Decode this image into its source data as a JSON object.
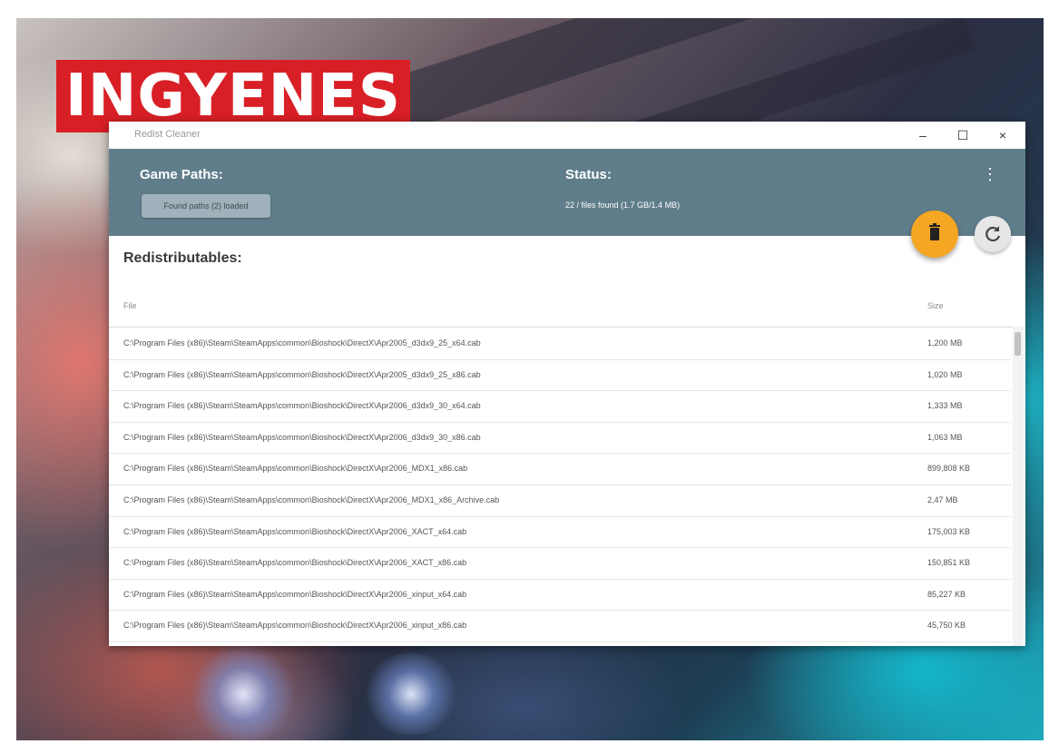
{
  "watermark": {
    "text": "INGYENES"
  },
  "window": {
    "title": "Redist Cleaner",
    "controls": {
      "minimize": "–",
      "maximize": "☐",
      "close": "×"
    }
  },
  "header": {
    "game_paths_label": "Game Paths:",
    "path_button_label": "Found paths (2) loaded",
    "status_label": "Status:",
    "status_text": "22 / files found (1.7 GB/1.4 MB)",
    "menu_icon": "⋮"
  },
  "actions": {
    "delete_icon": "trash-icon",
    "refresh_icon": "refresh-icon",
    "delete_color": "#f5a623"
  },
  "redistributables": {
    "title": "Redistributables:",
    "columns": {
      "file": "File",
      "size": "Size"
    },
    "rows": [
      {
        "file": "C:\\Program Files (x86)\\Steam\\SteamApps\\common\\Bioshock\\DirectX\\Apr2005_d3dx9_25_x64.cab",
        "size": "1,200 MB"
      },
      {
        "file": "C:\\Program Files (x86)\\Steam\\SteamApps\\common\\Bioshock\\DirectX\\Apr2005_d3dx9_25_x86.cab",
        "size": "1,020 MB"
      },
      {
        "file": "C:\\Program Files (x86)\\Steam\\SteamApps\\common\\Bioshock\\DirectX\\Apr2006_d3dx9_30_x64.cab",
        "size": "1,333 MB"
      },
      {
        "file": "C:\\Program Files (x86)\\Steam\\SteamApps\\common\\Bioshock\\DirectX\\Apr2006_d3dx9_30_x86.cab",
        "size": "1,063 MB"
      },
      {
        "file": "C:\\Program Files (x86)\\Steam\\SteamApps\\common\\Bioshock\\DirectX\\Apr2006_MDX1_x86.cab",
        "size": "899,808 KB"
      },
      {
        "file": "C:\\Program Files (x86)\\Steam\\SteamApps\\common\\Bioshock\\DirectX\\Apr2006_MDX1_x86_Archive.cab",
        "size": "2,47 MB"
      },
      {
        "file": "C:\\Program Files (x86)\\Steam\\SteamApps\\common\\Bioshock\\DirectX\\Apr2006_XACT_x64.cab",
        "size": "175,003 KB"
      },
      {
        "file": "C:\\Program Files (x86)\\Steam\\SteamApps\\common\\Bioshock\\DirectX\\Apr2006_XACT_x86.cab",
        "size": "150,851 KB"
      },
      {
        "file": "C:\\Program Files (x86)\\Steam\\SteamApps\\common\\Bioshock\\DirectX\\Apr2006_xinput_x64.cab",
        "size": "85,227 KB"
      },
      {
        "file": "C:\\Program Files (x86)\\Steam\\SteamApps\\common\\Bioshock\\DirectX\\Apr2006_xinput_x86.cab",
        "size": "45,750 KB"
      }
    ]
  }
}
